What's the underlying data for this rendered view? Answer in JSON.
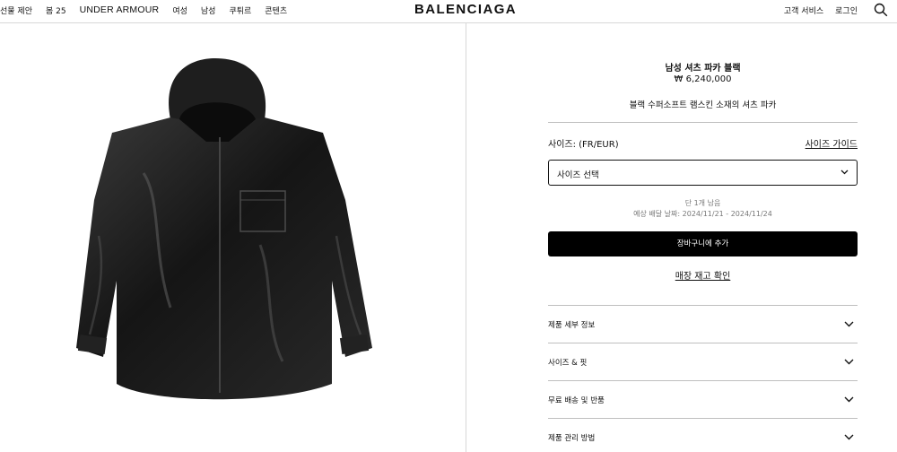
{
  "header": {
    "nav_left": [
      "선물 제안",
      "봄 25",
      "UNDER ARMOUR",
      "여성",
      "남성",
      "쿠튀르",
      "콘텐츠"
    ],
    "logo": "BALENCIAGA",
    "customer_service": "고객 서비스",
    "login": "로그인"
  },
  "product": {
    "name": "남성 셔츠 파카 블랙",
    "price": "₩ 6,240,000",
    "description": "블랙 수퍼소프트 램스킨 소재의 셔츠 파카",
    "image_alt": "black leather hooded shirt parka"
  },
  "size": {
    "label": "사이즈: (FR/EUR)",
    "guide": "사이즈 가이드",
    "select_placeholder": "사이즈 선택"
  },
  "availability": {
    "stock": "단 1개 남음",
    "delivery": "예상 배달 날짜: 2024/11/21 - 2024/11/24"
  },
  "actions": {
    "add_to_cart": "장바구니에 추가",
    "store_stock": "매장 재고 확인"
  },
  "accordion": [
    {
      "label": "제품 세부 정보"
    },
    {
      "label": "사이즈 & 핏"
    },
    {
      "label": "무료 배송 및 반품"
    },
    {
      "label": "제품 관리 방법"
    }
  ],
  "colors": {
    "accent": "#000000",
    "divider": "#d8d8d8"
  }
}
